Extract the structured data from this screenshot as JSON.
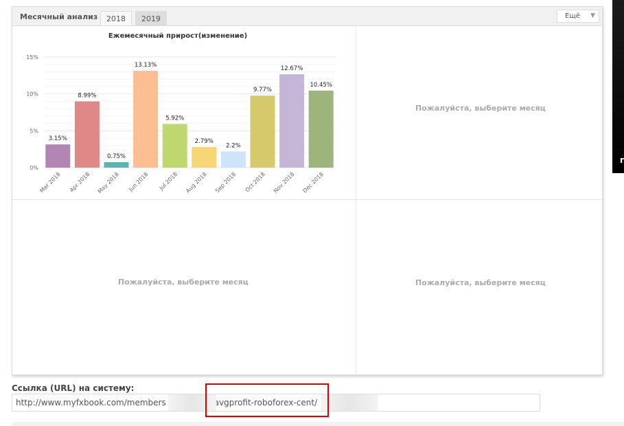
{
  "panel": {
    "title": "Месячный анализ",
    "tabs": [
      {
        "label": "2018",
        "active": true
      },
      {
        "label": "2019",
        "active": false
      }
    ],
    "more_label": "Ещё",
    "placeholder": "Пожалуйста, выберите месяц"
  },
  "chart_data": {
    "type": "bar",
    "title": "Ежемесячный прирост(изменение)",
    "categories": [
      "Mar 2018",
      "Apr 2018",
      "May 2018",
      "Jun 2018",
      "Jul 2018",
      "Aug 2018",
      "Sep 2018",
      "Oct 2018",
      "Nov 2018",
      "Dec 2018"
    ],
    "values": [
      3.15,
      8.99,
      0.75,
      13.13,
      5.92,
      2.79,
      2.2,
      9.77,
      12.67,
      10.45
    ],
    "data_labels": [
      "3.15%",
      "8.99%",
      "0.75%",
      "13.13%",
      "5.92%",
      "2.79%",
      "2.2%",
      "9.77%",
      "12.67%",
      "10.45%"
    ],
    "colors": [
      "#b385b4",
      "#e08888",
      "#5bb3b3",
      "#fdbe94",
      "#bcd86e",
      "#f6d677",
      "#cfe4f8",
      "#d4ca6c",
      "#c5b5d6",
      "#9db57c"
    ],
    "yticks": [
      "0%",
      "5%",
      "10%",
      "15%"
    ],
    "ylim": [
      0,
      15
    ],
    "grid": true
  },
  "link": {
    "label": "Ссылка (URL) на систему:",
    "url_start": "http://www.myfxbook.com/members",
    "url_mid": "avgprofit-roboforex-cent/"
  },
  "side": {
    "letter": "r"
  }
}
